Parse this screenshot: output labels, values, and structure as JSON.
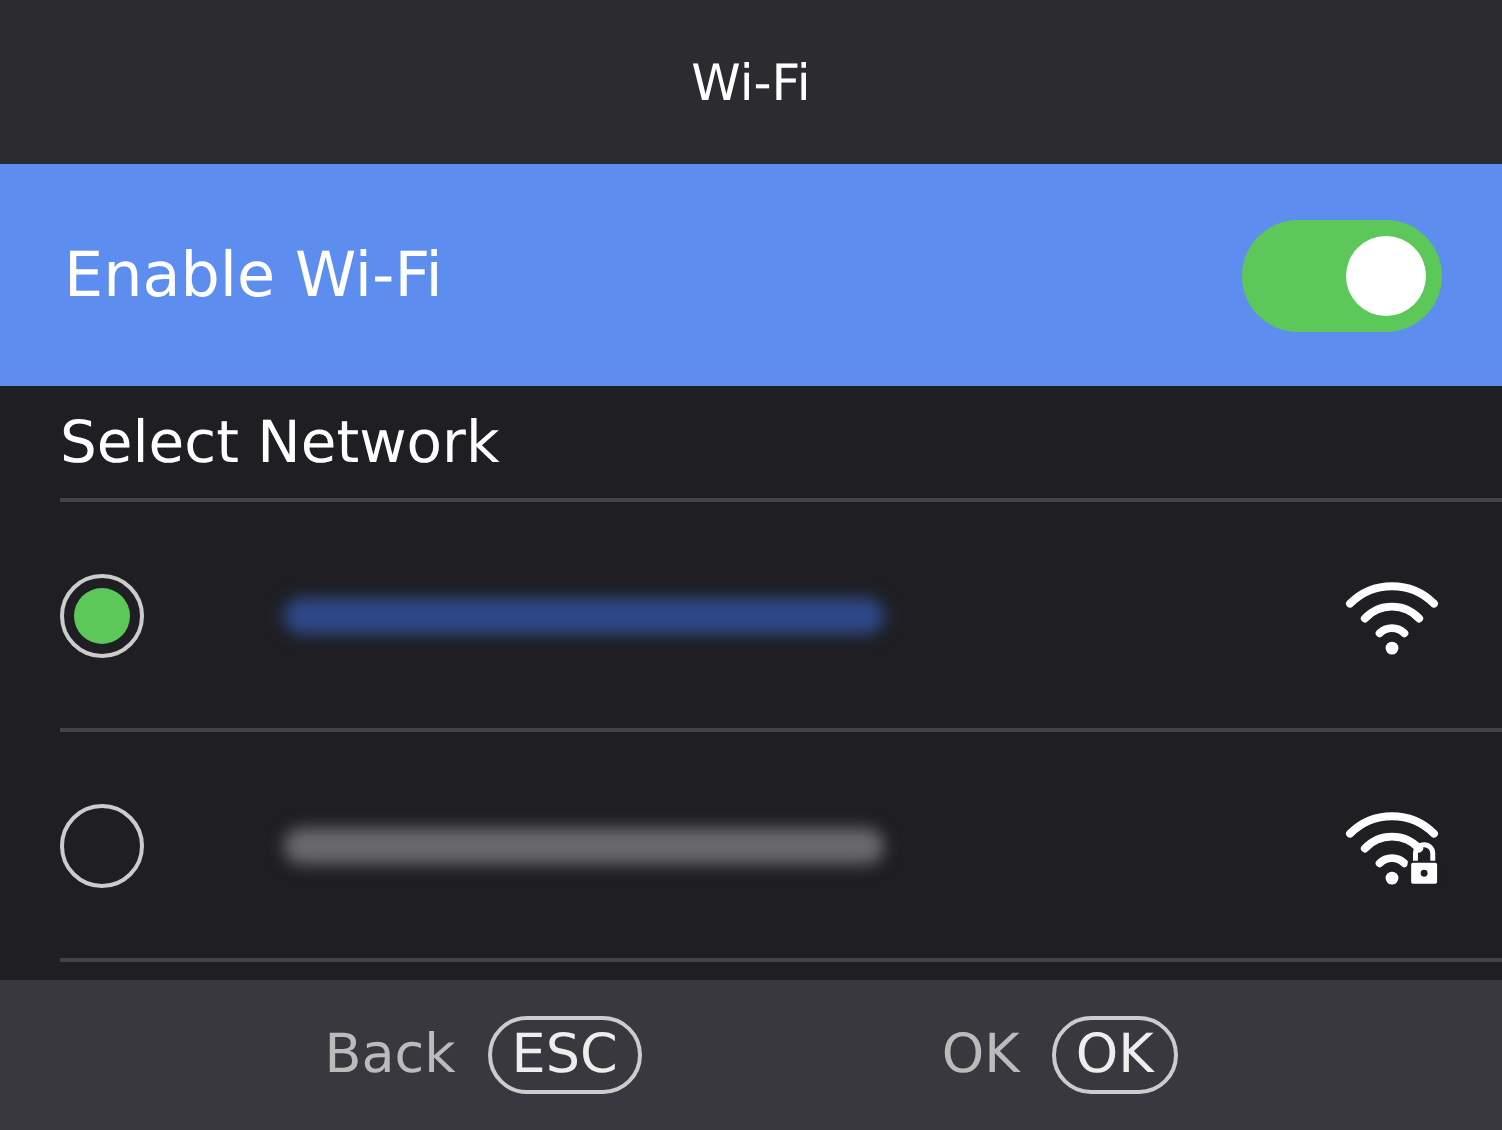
{
  "header": {
    "title": "Wi-Fi"
  },
  "enable_wifi": {
    "label": "Enable Wi-Fi",
    "on": true
  },
  "section_title": "Select Network",
  "networks": [
    {
      "selected": true,
      "locked": false,
      "color": "#2e4a8a"
    },
    {
      "selected": false,
      "locked": true,
      "color": "#6a6a6e"
    }
  ],
  "footer": [
    {
      "label": "Back",
      "key": "ESC"
    },
    {
      "label": "OK",
      "key": "OK"
    }
  ]
}
